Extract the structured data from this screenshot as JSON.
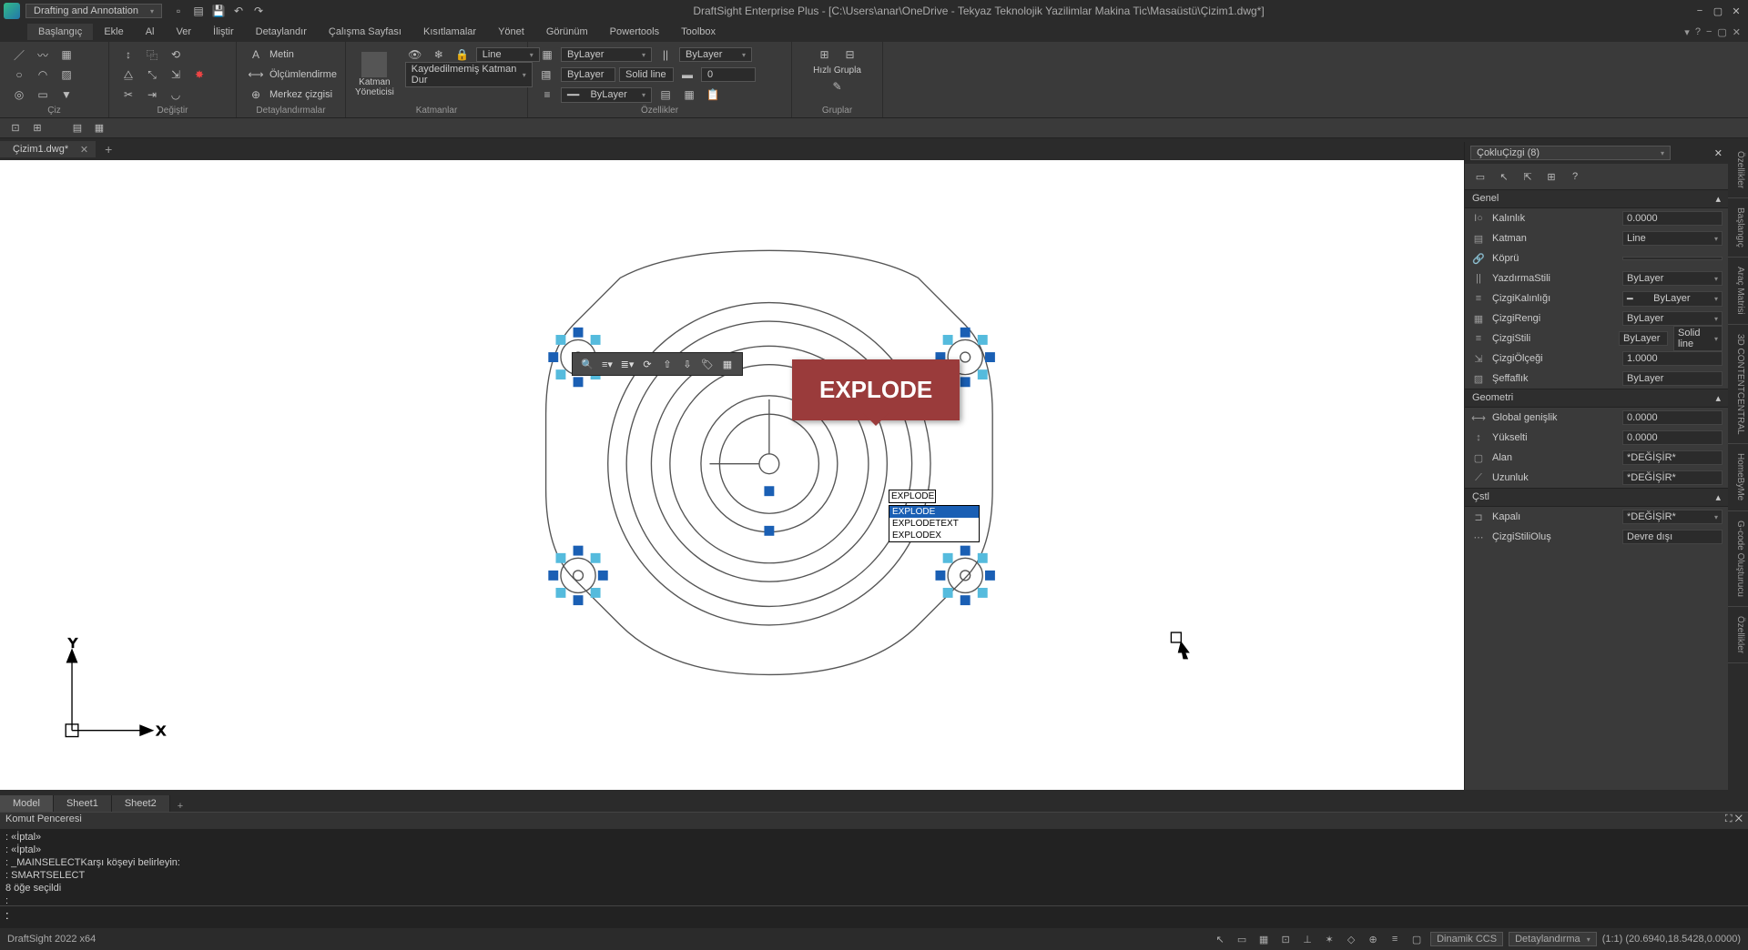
{
  "titlebar": {
    "workspace": "Drafting and Annotation",
    "title": "DraftSight Enterprise Plus - [C:\\Users\\anar\\OneDrive - Tekyaz Teknolojik Yazilimlar Makina Tic\\Masaüstü\\Çizim1.dwg*]"
  },
  "tabs": {
    "items": [
      "Başlangıç",
      "Ekle",
      "Al",
      "Ver",
      "İliştir",
      "Detaylandır",
      "Çalışma Sayfası",
      "Kısıtlamalar",
      "Yönet",
      "Görünüm",
      "Powertools",
      "Toolbox"
    ],
    "active": 0
  },
  "ribbon": {
    "panel_draw": "Çiz",
    "panel_modify": "Değiştir",
    "panel_annot": "Detaylandırmalar",
    "panel_layers": "Katmanlar",
    "panel_props": "Özellikler",
    "panel_groups": "Gruplar",
    "text_btn": "Metin",
    "dim_btn": "Ölçümlendirme",
    "center_btn": "Merkez çizgisi",
    "layermgr": "Katman Yöneticisi",
    "layer_drop": "Line",
    "unsaved_layer": "Kaydedilmemiş Katman Dur",
    "bylayer": "ByLayer",
    "solidline": "Solid line",
    "zero": "0",
    "quickgroup": "Hızlı Grupla"
  },
  "doctab": {
    "name": "Çizim1.dwg*"
  },
  "properties": {
    "header": "ÇokluÇizgi (8)",
    "sec_general": "Genel",
    "sec_geom": "Geometri",
    "sec_cstl": "Çstl",
    "rows": {
      "thickness": {
        "lbl": "Kalınlık",
        "val": "0.0000"
      },
      "layer": {
        "lbl": "Katman",
        "val": "Line"
      },
      "link": {
        "lbl": "Köprü",
        "val": ""
      },
      "printstyle": {
        "lbl": "YazdırmaStili",
        "val": "ByLayer"
      },
      "lineweight": {
        "lbl": "ÇizgiKalınlığı",
        "val": "ByLayer"
      },
      "linecolor": {
        "lbl": "ÇizgiRengi",
        "val": "ByLayer"
      },
      "linestyle": {
        "lbl": "ÇizgiStili",
        "val": "ByLayer"
      },
      "linestyle2": {
        "lbl2": "Solid line"
      },
      "linescale": {
        "lbl": "ÇizgiÖlçeği",
        "val": "1.0000"
      },
      "transp": {
        "lbl": "Şeffaflık",
        "val": "ByLayer"
      },
      "globwidth": {
        "lbl": "Global genişlik",
        "val": "0.0000"
      },
      "elev": {
        "lbl": "Yükselti",
        "val": "0.0000"
      },
      "area": {
        "lbl": "Alan",
        "val": "*DEĞİŞİR*"
      },
      "length": {
        "lbl": "Uzunluk",
        "val": "*DEĞİŞİR*"
      },
      "closed": {
        "lbl": "Kapalı",
        "val": "*DEĞİŞİR*"
      },
      "genstyle": {
        "lbl": "ÇizgiStiliOluş",
        "val": "Devre dışı"
      }
    }
  },
  "rvtabs": [
    "Özellikler",
    "Başlangıç",
    "Araç Matrisi",
    "3D CONTENTCENTRAL",
    "HomeByMe",
    "G-code Oluşturucu",
    "Özellikler"
  ],
  "callout": "EXPLODE",
  "cmdinput": "EXPLODE",
  "cmdsuggest": [
    "EXPLODE",
    "EXPLODETEXT",
    "EXPLODEX"
  ],
  "sheets": {
    "items": [
      "Model",
      "Sheet1",
      "Sheet2"
    ],
    "active": 0
  },
  "cmdwin": {
    "title": "Komut Penceresi",
    "lines": [
      ": «İptal»",
      ": «İptal»",
      ": _MAINSELECTKarşı köşeyi belirleyin:",
      ": SMARTSELECT",
      "8 öğe seçildi",
      ":"
    ],
    "prompt": ":"
  },
  "status": {
    "left": "DraftSight 2022 x64",
    "dcs": "Dinamik CCS",
    "annot": "Detaylandırma",
    "coords": "(1:1)  (20.6940,18.5428,0.0000)"
  }
}
